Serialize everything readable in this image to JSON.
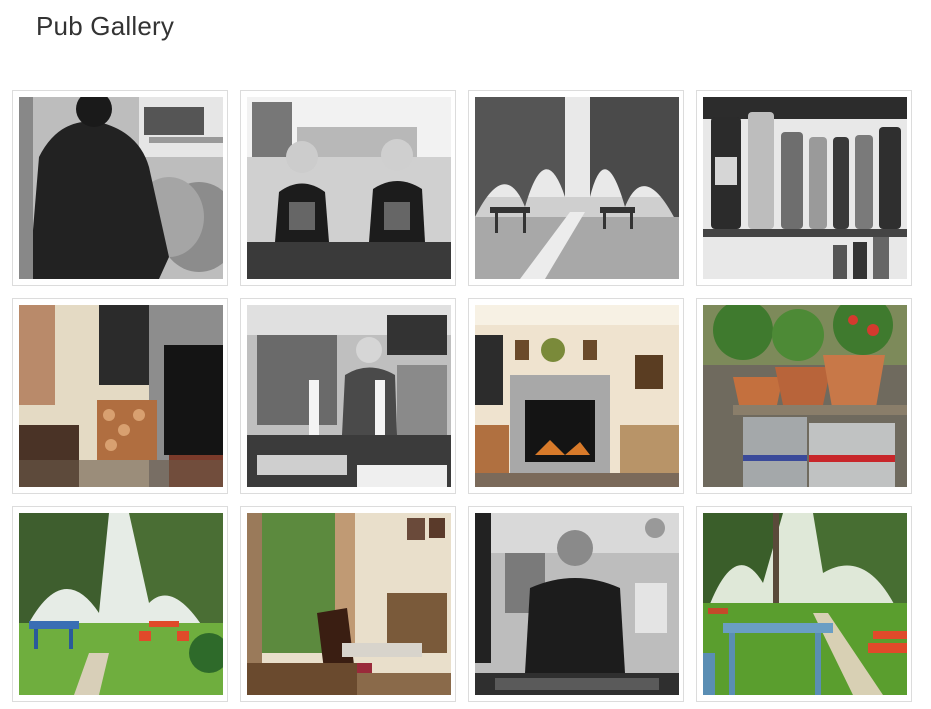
{
  "page": {
    "title": "Pub Gallery"
  },
  "gallery": {
    "items": [
      {
        "id": 1,
        "scene": "bartender-changing-keg",
        "mode": "mono"
      },
      {
        "id": 2,
        "scene": "two-barmaids-at-bar",
        "mode": "mono"
      },
      {
        "id": 3,
        "scene": "garden-path-benches",
        "mode": "mono"
      },
      {
        "id": 4,
        "scene": "spirits-shelf",
        "mode": "mono"
      },
      {
        "id": 5,
        "scene": "fireplace-with-logs",
        "mode": "color"
      },
      {
        "id": 6,
        "scene": "landlord-pulling-pints",
        "mode": "mono"
      },
      {
        "id": 7,
        "scene": "fireplace-room",
        "mode": "color"
      },
      {
        "id": 8,
        "scene": "flower-pots-on-kegs",
        "mode": "color"
      },
      {
        "id": 9,
        "scene": "beer-garden-blue-table",
        "mode": "color"
      },
      {
        "id": 10,
        "scene": "window-chairs-interior",
        "mode": "color"
      },
      {
        "id": 11,
        "scene": "landlord-behind-bar",
        "mode": "mono"
      },
      {
        "id": 12,
        "scene": "beer-garden-lawn",
        "mode": "color"
      }
    ]
  }
}
